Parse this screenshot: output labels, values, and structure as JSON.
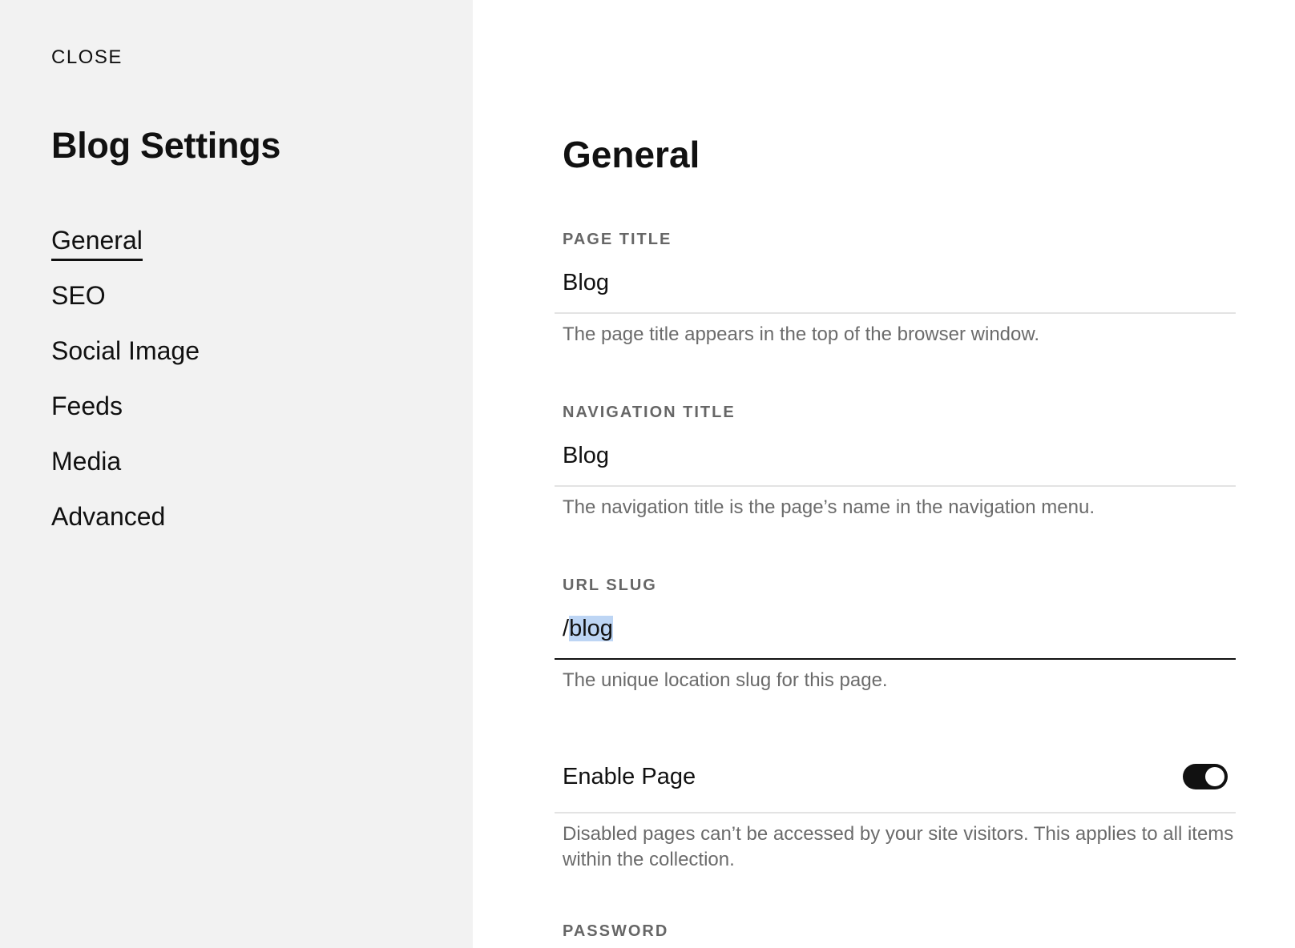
{
  "sidebar": {
    "close_label": "CLOSE",
    "title": "Blog Settings",
    "items": [
      {
        "label": "General",
        "active": true
      },
      {
        "label": "SEO"
      },
      {
        "label": "Social Image"
      },
      {
        "label": "Feeds"
      },
      {
        "label": "Media"
      },
      {
        "label": "Advanced"
      }
    ]
  },
  "main": {
    "title": "General",
    "page_title": {
      "label": "PAGE TITLE",
      "value": "Blog",
      "help": "The page title appears in the top of the browser window."
    },
    "navigation_title": {
      "label": "NAVIGATION TITLE",
      "value": "Blog",
      "help": "The navigation title is the page’s name in the navigation menu."
    },
    "url_slug": {
      "label": "URL SLUG",
      "prefix": "/",
      "value": "blog",
      "help": "The unique location slug for this page."
    },
    "enable_page": {
      "label": "Enable Page",
      "enabled": true,
      "help": "Disabled pages can’t be accessed by your site visitors. This applies to all items within the collection."
    },
    "password": {
      "label": "PASSWORD"
    }
  },
  "colors": {
    "sidebar_bg": "#f2f2f2",
    "accent": "#111111",
    "selection": "#bdd5f4",
    "help_text": "#6b6b6b"
  }
}
